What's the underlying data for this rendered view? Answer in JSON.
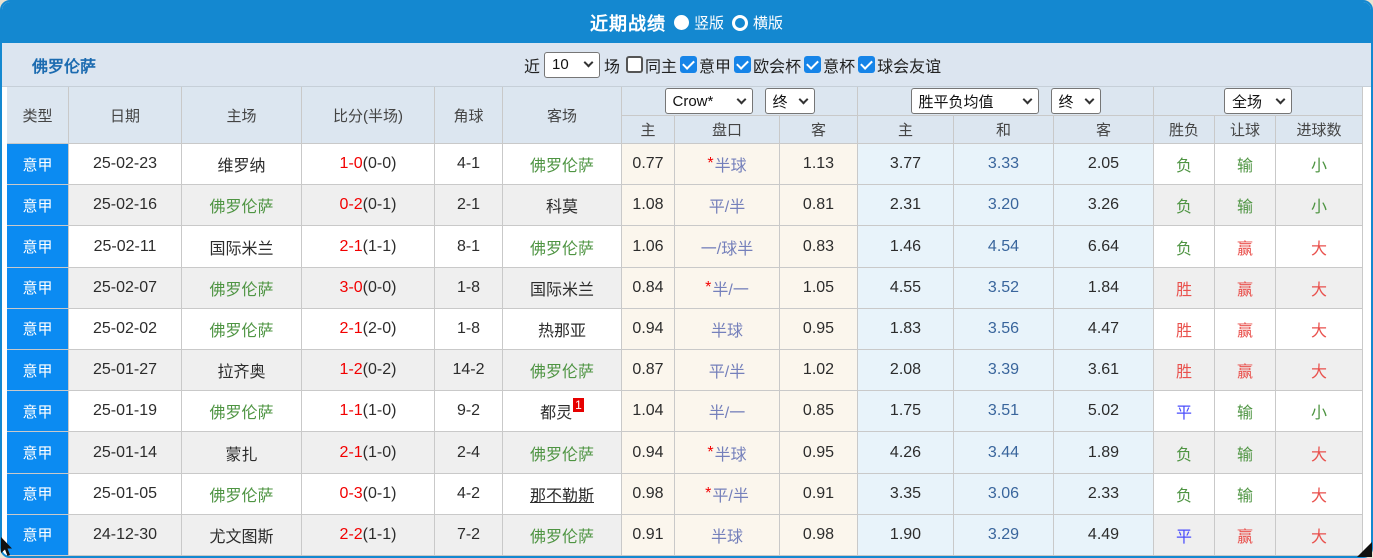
{
  "topbar": {
    "title": "近期战绩",
    "radio_vertical": "竖版",
    "radio_horizontal": "横版"
  },
  "filterbar": {
    "team": "佛罗伦萨",
    "near_label": "近",
    "match_count": "10",
    "field_label": "场",
    "checkboxes": [
      {
        "label": "同主",
        "checked": false
      },
      {
        "label": "意甲",
        "checked": true
      },
      {
        "label": "欧会杯",
        "checked": true
      },
      {
        "label": "意杯",
        "checked": true
      },
      {
        "label": "球会友谊",
        "checked": true
      }
    ]
  },
  "header": {
    "static_cols": [
      "类型",
      "日期",
      "主场",
      "比分(半场)",
      "角球",
      "客场"
    ],
    "odds_dropdown": "Crow*",
    "odds_final_dropdown": "终",
    "avg_dropdown": "胜平负均值",
    "avg_final_dropdown": "终",
    "result_dropdown": "全场",
    "odds_sub": [
      "主",
      "盘口",
      "客"
    ],
    "avg_sub": [
      "主",
      "和",
      "客"
    ],
    "result_sub": [
      "胜负",
      "让球",
      "进球数"
    ]
  },
  "colors": {
    "bar_blue": "#1488d0",
    "league_cell_blue": "#0b8bf2",
    "header_bg": "#dce6f0",
    "odds_col_bg": "#fbf6ed",
    "avg_col_bg": "#e8f3fa",
    "alt_row_bg": "#efefef",
    "win_red": "#e9514d",
    "lose_green": "#4e9442",
    "draw_blue": "#4b4efc",
    "score_red": "#f20000",
    "handicap_text": "#7580bb",
    "team_green": "#4e9442"
  },
  "rows": [
    {
      "league": "意甲",
      "date": "25-02-23",
      "home": {
        "name": "维罗纳",
        "green": false
      },
      "score": {
        "main": "1-0",
        "half": "(0-0)"
      },
      "corner": "4-1",
      "away": {
        "name": "佛罗伦萨",
        "green": true,
        "badge": null,
        "underline": false
      },
      "crow": {
        "home": "0.77",
        "star": true,
        "pan": "半球",
        "away": "1.13"
      },
      "avg": {
        "home": "3.77",
        "draw": "3.33",
        "away": "2.05"
      },
      "outcome": {
        "text": "负",
        "color": "green"
      },
      "handicap": {
        "text": "输",
        "color": "green"
      },
      "goals": {
        "text": "小",
        "color": "green"
      }
    },
    {
      "league": "意甲",
      "date": "25-02-16",
      "home": {
        "name": "佛罗伦萨",
        "green": true
      },
      "score": {
        "main": "0-2",
        "half": "(0-1)"
      },
      "corner": "2-1",
      "away": {
        "name": "科莫",
        "green": false,
        "badge": null,
        "underline": false
      },
      "crow": {
        "home": "1.08",
        "star": false,
        "pan": "平/半",
        "away": "0.81"
      },
      "avg": {
        "home": "2.31",
        "draw": "3.20",
        "away": "3.26"
      },
      "outcome": {
        "text": "负",
        "color": "green"
      },
      "handicap": {
        "text": "输",
        "color": "green"
      },
      "goals": {
        "text": "小",
        "color": "green"
      }
    },
    {
      "league": "意甲",
      "date": "25-02-11",
      "home": {
        "name": "国际米兰",
        "green": false
      },
      "score": {
        "main": "2-1",
        "half": "(1-1)"
      },
      "corner": "8-1",
      "away": {
        "name": "佛罗伦萨",
        "green": true,
        "badge": null,
        "underline": false
      },
      "crow": {
        "home": "1.06",
        "star": false,
        "pan": "一/球半",
        "away": "0.83"
      },
      "avg": {
        "home": "1.46",
        "draw": "4.54",
        "away": "6.64"
      },
      "outcome": {
        "text": "负",
        "color": "green"
      },
      "handicap": {
        "text": "赢",
        "color": "red"
      },
      "goals": {
        "text": "大",
        "color": "red"
      }
    },
    {
      "league": "意甲",
      "date": "25-02-07",
      "home": {
        "name": "佛罗伦萨",
        "green": true
      },
      "score": {
        "main": "3-0",
        "half": "(0-0)"
      },
      "corner": "1-8",
      "away": {
        "name": "国际米兰",
        "green": false,
        "badge": null,
        "underline": false
      },
      "crow": {
        "home": "0.84",
        "star": true,
        "pan": "半/一",
        "away": "1.05"
      },
      "avg": {
        "home": "4.55",
        "draw": "3.52",
        "away": "1.84"
      },
      "outcome": {
        "text": "胜",
        "color": "red"
      },
      "handicap": {
        "text": "赢",
        "color": "red"
      },
      "goals": {
        "text": "大",
        "color": "red"
      }
    },
    {
      "league": "意甲",
      "date": "25-02-02",
      "home": {
        "name": "佛罗伦萨",
        "green": true
      },
      "score": {
        "main": "2-1",
        "half": "(2-0)"
      },
      "corner": "1-8",
      "away": {
        "name": "热那亚",
        "green": false,
        "badge": null,
        "underline": false
      },
      "crow": {
        "home": "0.94",
        "star": false,
        "pan": "半球",
        "away": "0.95"
      },
      "avg": {
        "home": "1.83",
        "draw": "3.56",
        "away": "4.47"
      },
      "outcome": {
        "text": "胜",
        "color": "red"
      },
      "handicap": {
        "text": "赢",
        "color": "red"
      },
      "goals": {
        "text": "大",
        "color": "red"
      }
    },
    {
      "league": "意甲",
      "date": "25-01-27",
      "home": {
        "name": "拉齐奥",
        "green": false
      },
      "score": {
        "main": "1-2",
        "half": "(0-2)"
      },
      "corner": "14-2",
      "away": {
        "name": "佛罗伦萨",
        "green": true,
        "badge": null,
        "underline": false
      },
      "crow": {
        "home": "0.87",
        "star": false,
        "pan": "平/半",
        "away": "1.02"
      },
      "avg": {
        "home": "2.08",
        "draw": "3.39",
        "away": "3.61"
      },
      "outcome": {
        "text": "胜",
        "color": "red"
      },
      "handicap": {
        "text": "赢",
        "color": "red"
      },
      "goals": {
        "text": "大",
        "color": "red"
      }
    },
    {
      "league": "意甲",
      "date": "25-01-19",
      "home": {
        "name": "佛罗伦萨",
        "green": true
      },
      "score": {
        "main": "1-1",
        "half": "(1-0)"
      },
      "corner": "9-2",
      "away": {
        "name": "都灵",
        "green": false,
        "badge": "1",
        "underline": false
      },
      "crow": {
        "home": "1.04",
        "star": false,
        "pan": "半/一",
        "away": "0.85"
      },
      "avg": {
        "home": "1.75",
        "draw": "3.51",
        "away": "5.02"
      },
      "outcome": {
        "text": "平",
        "color": "blue"
      },
      "handicap": {
        "text": "输",
        "color": "green"
      },
      "goals": {
        "text": "小",
        "color": "green"
      }
    },
    {
      "league": "意甲",
      "date": "25-01-14",
      "home": {
        "name": "蒙扎",
        "green": false
      },
      "score": {
        "main": "2-1",
        "half": "(1-0)"
      },
      "corner": "2-4",
      "away": {
        "name": "佛罗伦萨",
        "green": true,
        "badge": null,
        "underline": false
      },
      "crow": {
        "home": "0.94",
        "star": true,
        "pan": "半球",
        "away": "0.95"
      },
      "avg": {
        "home": "4.26",
        "draw": "3.44",
        "away": "1.89"
      },
      "outcome": {
        "text": "负",
        "color": "green"
      },
      "handicap": {
        "text": "输",
        "color": "green"
      },
      "goals": {
        "text": "大",
        "color": "red"
      }
    },
    {
      "league": "意甲",
      "date": "25-01-05",
      "home": {
        "name": "佛罗伦萨",
        "green": true
      },
      "score": {
        "main": "0-3",
        "half": "(0-1)"
      },
      "corner": "4-2",
      "away": {
        "name": "那不勒斯",
        "green": false,
        "badge": null,
        "underline": true
      },
      "crow": {
        "home": "0.98",
        "star": true,
        "pan": "平/半",
        "away": "0.91"
      },
      "avg": {
        "home": "3.35",
        "draw": "3.06",
        "away": "2.33"
      },
      "outcome": {
        "text": "负",
        "color": "green"
      },
      "handicap": {
        "text": "输",
        "color": "green"
      },
      "goals": {
        "text": "大",
        "color": "red"
      }
    },
    {
      "league": "意甲",
      "date": "24-12-30",
      "home": {
        "name": "尤文图斯",
        "green": false
      },
      "score": {
        "main": "2-2",
        "half": "(1-1)"
      },
      "corner": "7-2",
      "away": {
        "name": "佛罗伦萨",
        "green": true,
        "badge": null,
        "underline": false
      },
      "crow": {
        "home": "0.91",
        "star": false,
        "pan": "半球",
        "away": "0.98"
      },
      "avg": {
        "home": "1.90",
        "draw": "3.29",
        "away": "4.49"
      },
      "outcome": {
        "text": "平",
        "color": "blue"
      },
      "handicap": {
        "text": "赢",
        "color": "red"
      },
      "goals": {
        "text": "大",
        "color": "red"
      }
    }
  ]
}
